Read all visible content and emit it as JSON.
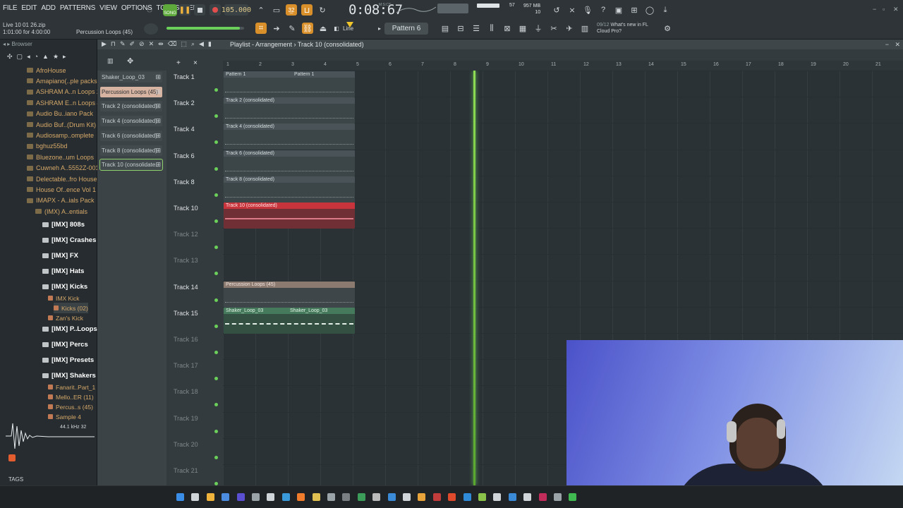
{
  "menu": [
    "FILE",
    "EDIT",
    "ADD",
    "PATTERNS",
    "VIEW",
    "OPTIONS",
    "TOOLS",
    "HELP"
  ],
  "hint": {
    "line1": "Live 10 01 26.zip",
    "line2": "1:01:00 for 4:00:00",
    "right": "Percussion Loops (45)"
  },
  "transport": {
    "song_label": "SONG",
    "tempo": "105.000",
    "time": "0:08:67",
    "time_unit": "M:S:CS",
    "pattern": "Pattern 6",
    "snap": "Line",
    "cpu": "57",
    "memory": "957 MB",
    "memory_sub": "10"
  },
  "news": {
    "date": "09/12",
    "line1": "What's new in FL",
    "line2": "Cloud Pro?"
  },
  "browser": {
    "title": "Browser",
    "items": [
      {
        "label": "AfroHouse",
        "kind": "folder"
      },
      {
        "label": "Amapiano(..ple packs",
        "kind": "folder"
      },
      {
        "label": "ASHRAM A..n Loops 2",
        "kind": "folder"
      },
      {
        "label": "ASHRAM E..n Loops 4",
        "kind": "folder"
      },
      {
        "label": "Audio Bu..iano Pack",
        "kind": "folder"
      },
      {
        "label": "Audio Buf..(Drum Kit)",
        "kind": "folder"
      },
      {
        "label": "Audiosamp..omplete",
        "kind": "folder"
      },
      {
        "label": "bghuz55bd",
        "kind": "folder"
      },
      {
        "label": "Bluezone..um Loops",
        "kind": "folder"
      },
      {
        "label": "Cuwneh A..5552Z-001",
        "kind": "folder"
      },
      {
        "label": "Delectable..fro House",
        "kind": "folder"
      },
      {
        "label": "House Of..ence Vol 1",
        "kind": "folder"
      },
      {
        "label": "IMAPX - A..ials Pack",
        "kind": "folder"
      },
      {
        "label": "(IMX) A..entials",
        "kind": "folder"
      },
      {
        "label": "[IMX] 808s",
        "kind": "imx"
      },
      {
        "label": "[IMX] Crashes",
        "kind": "imx"
      },
      {
        "label": "[IMX] FX",
        "kind": "imx"
      },
      {
        "label": "[IMX] Hats",
        "kind": "imx"
      },
      {
        "label": "[IMX] Kicks",
        "kind": "imx"
      },
      {
        "label": "IMX Kick",
        "kind": "sample"
      },
      {
        "label": "Kicks (02)",
        "kind": "sample"
      },
      {
        "label": "Zan's Kick",
        "kind": "sample"
      },
      {
        "label": "[IMX] P..Loops",
        "kind": "imx"
      },
      {
        "label": "[IMX] Percs",
        "kind": "imx"
      },
      {
        "label": "[IMX] Presets",
        "kind": "imx"
      },
      {
        "label": "[IMX] Shakers",
        "kind": "imx"
      },
      {
        "label": "Fanarit..Part_1",
        "kind": "sample"
      },
      {
        "label": "Mello..ER (11)",
        "kind": "sample"
      },
      {
        "label": "Percus..s (45)",
        "kind": "sample"
      },
      {
        "label": "Sample 4",
        "kind": "sample"
      }
    ],
    "sample_info": "44.1 kHz 32",
    "tags_label": "TAGS"
  },
  "playlist": {
    "title": "Playlist - Arrangement",
    "current_track": "Track 10 (consolidated)",
    "patterns": [
      "Shaker_Loop_03",
      "Percussion Loops (45)",
      "Track 2 (consolidated)",
      "Track 4 (consolidated)",
      "Track 6 (consolidated)",
      "Track 8 (consolidated)",
      "Track 10 (consolidate.."
    ],
    "ruler": [
      "1",
      "2",
      "3",
      "4",
      "5",
      "6",
      "7",
      "8",
      "9",
      "10",
      "11",
      "12",
      "13",
      "14",
      "15",
      "16",
      "17",
      "18",
      "19",
      "20",
      "21"
    ],
    "tracks": [
      {
        "name": "Track 1"
      },
      {
        "name": "Track 2"
      },
      {
        "name": "Track 4"
      },
      {
        "name": "Track 6"
      },
      {
        "name": "Track 8"
      },
      {
        "name": "Track 10"
      },
      {
        "name": "Track 12"
      },
      {
        "name": "Track 13"
      },
      {
        "name": "Track 14"
      },
      {
        "name": "Track 15"
      },
      {
        "name": "Track 16"
      },
      {
        "name": "Track 17"
      },
      {
        "name": "Track 18"
      },
      {
        "name": "Track 19"
      },
      {
        "name": "Track 20"
      },
      {
        "name": "Track 21"
      }
    ],
    "clips": [
      {
        "label": "Pattern 1",
        "label2": "Pattern 1",
        "track": 0,
        "style": "pattern"
      },
      {
        "label": "Track 2 (consolidated)",
        "track": 1,
        "style": "audio"
      },
      {
        "label": "Track 4 (consolidated)",
        "track": 2,
        "style": "audio"
      },
      {
        "label": "Track 6 (consolidated)",
        "track": 3,
        "style": "audio"
      },
      {
        "label": "Track 8 (consolidated)",
        "track": 4,
        "style": "audio"
      },
      {
        "label": "Track 10 (consolidated)",
        "track": 5,
        "style": "red"
      },
      {
        "label": "Percussion Loops (45)",
        "track": 8,
        "style": "perc"
      },
      {
        "label": "Shaker_Loop_03",
        "label2": "Shaker_Loop_03",
        "track": 9,
        "style": "shaker"
      }
    ]
  },
  "colors": {
    "accent_green": "#6bd05a",
    "clip_red": "#c8343c",
    "playhead": "#8edb54",
    "webcam_bg": "#4b52c9"
  }
}
